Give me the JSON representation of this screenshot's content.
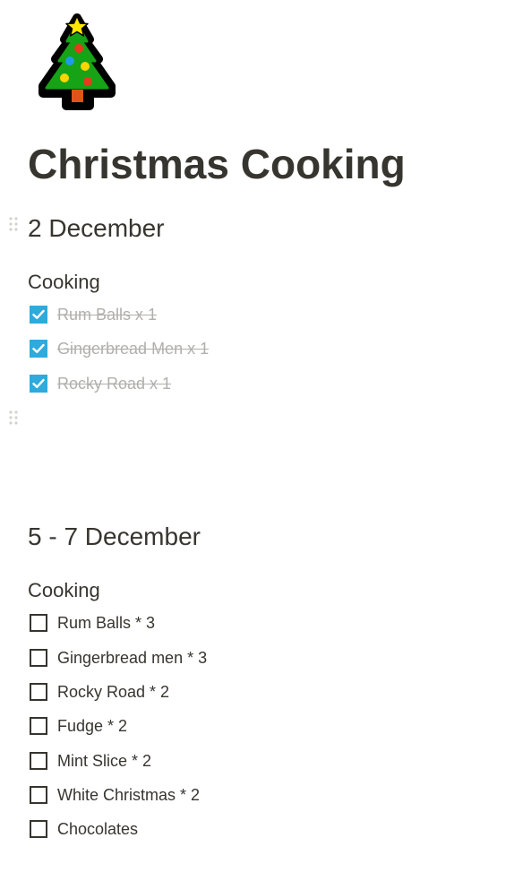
{
  "page": {
    "icon": "christmas-tree-icon",
    "title": "Christmas Cooking"
  },
  "colors": {
    "text": "#37352f",
    "checkbox_checked": "#2eaadc",
    "done_text": "#b0afad"
  },
  "sections": [
    {
      "heading": "2 December",
      "subheading": "Cooking",
      "todos": [
        {
          "label": "Rum Balls x 1",
          "checked": true
        },
        {
          "label": "Gingerbread Men x 1",
          "checked": true
        },
        {
          "label": "Rocky Road x 1",
          "checked": true
        }
      ]
    },
    {
      "heading": "5 - 7 December",
      "subheading": "Cooking",
      "todos": [
        {
          "label": "Rum Balls * 3",
          "checked": false
        },
        {
          "label": "Gingerbread men * 3",
          "checked": false
        },
        {
          "label": "Rocky Road * 2",
          "checked": false
        },
        {
          "label": "Fudge * 2",
          "checked": false
        },
        {
          "label": "Mint Slice * 2",
          "checked": false
        },
        {
          "label": "White Christmas * 2",
          "checked": false
        },
        {
          "label": "Chocolates",
          "checked": false
        }
      ]
    }
  ]
}
